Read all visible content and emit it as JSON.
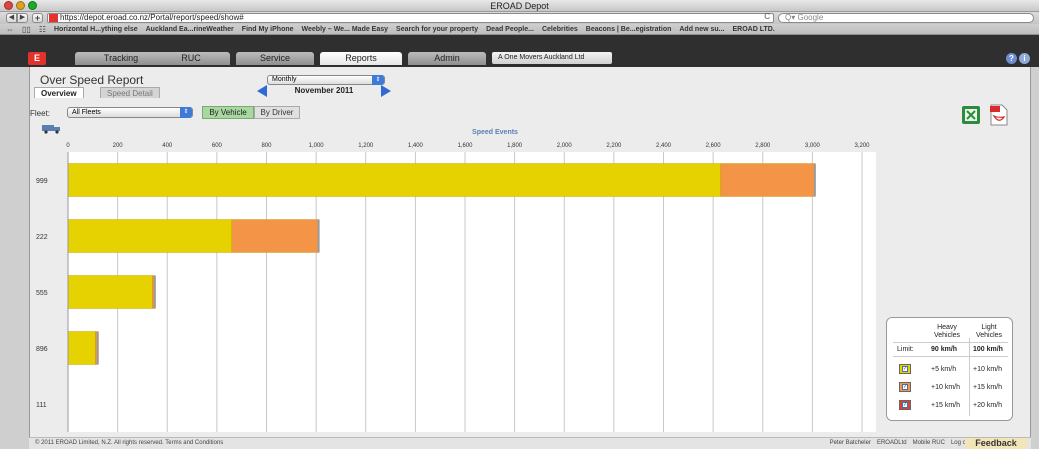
{
  "browser": {
    "window_title": "EROAD Depot",
    "url": "https://depot.eroad.co.nz/Portal/report/speed/show#",
    "search_placeholder": "Google",
    "bookmarks": [
      "Horizontal H...ything else",
      "Auckland Ea...rineWeather",
      "Find My iPhone",
      "Weebly – We... Made Easy",
      "Search for your property",
      "Dead People...",
      "Celebrities",
      "Beacons | Be...egistration",
      "Add new su...",
      "EROAD LTD."
    ]
  },
  "app": {
    "logo_text": "E",
    "nav_tabs": [
      "Tracking",
      "RUC",
      "Service",
      "Reports",
      "Admin"
    ],
    "active_tab": "Reports",
    "account": "A One Movers Auckland Ltd"
  },
  "report": {
    "title": "Over Speed Report",
    "subtabs": [
      "Overview",
      "Speed Detail"
    ],
    "period": "Monthly",
    "month": "November 2011",
    "fleet_label": "Fleet:",
    "fleet_value": "All Fleets",
    "by_vehicle": "By Vehicle",
    "by_driver": "By Driver"
  },
  "chart_data": {
    "type": "bar",
    "orientation": "horizontal",
    "stacked": true,
    "title": "Speed Events",
    "categories": [
      "999",
      "222",
      "555",
      "896",
      "111"
    ],
    "series": [
      {
        "name": "+5 km/h / +10 km/h",
        "color": "#e6d200",
        "values": [
          2630,
          660,
          340,
          110,
          0
        ]
      },
      {
        "name": "+10 km/h / +15 km/h",
        "color": "#f39447",
        "values": [
          380,
          350,
          10,
          10,
          0
        ]
      },
      {
        "name": "+15 km/h / +20 km/h",
        "color": "#d9413a",
        "values": [
          0,
          0,
          0,
          0,
          0
        ]
      }
    ],
    "xlim": [
      0,
      3200
    ],
    "xticks": [
      "0",
      "200",
      "400",
      "600",
      "800",
      "1,000",
      "1,200",
      "1,400",
      "1,600",
      "1,800",
      "2,000",
      "2,200",
      "2,400",
      "2,600",
      "2,800",
      "3,000",
      "3,200"
    ],
    "grid": true
  },
  "legend": {
    "col_heavy": "Heavy Vehicles",
    "col_light": "Light Vehicles",
    "limit_label": "Limit:",
    "limit_heavy": "90 km/h",
    "limit_light": "100 km/h",
    "rows": [
      {
        "heavy": "+5 km/h",
        "light": "+10 km/h",
        "color": "#e6d200"
      },
      {
        "heavy": "+10 km/h",
        "light": "+15 km/h",
        "color": "#f39447"
      },
      {
        "heavy": "+15 km/h",
        "light": "+20 km/h",
        "color": "#d9413a"
      }
    ]
  },
  "footer": {
    "copyright": "© 2011 EROAD Limited, N.Z. All rights reserved. Terms and Conditions",
    "links": [
      "Peter Batcheler",
      "EROADLtd",
      "Mobile RUC",
      "Log out"
    ],
    "feedback": "Feedback"
  }
}
